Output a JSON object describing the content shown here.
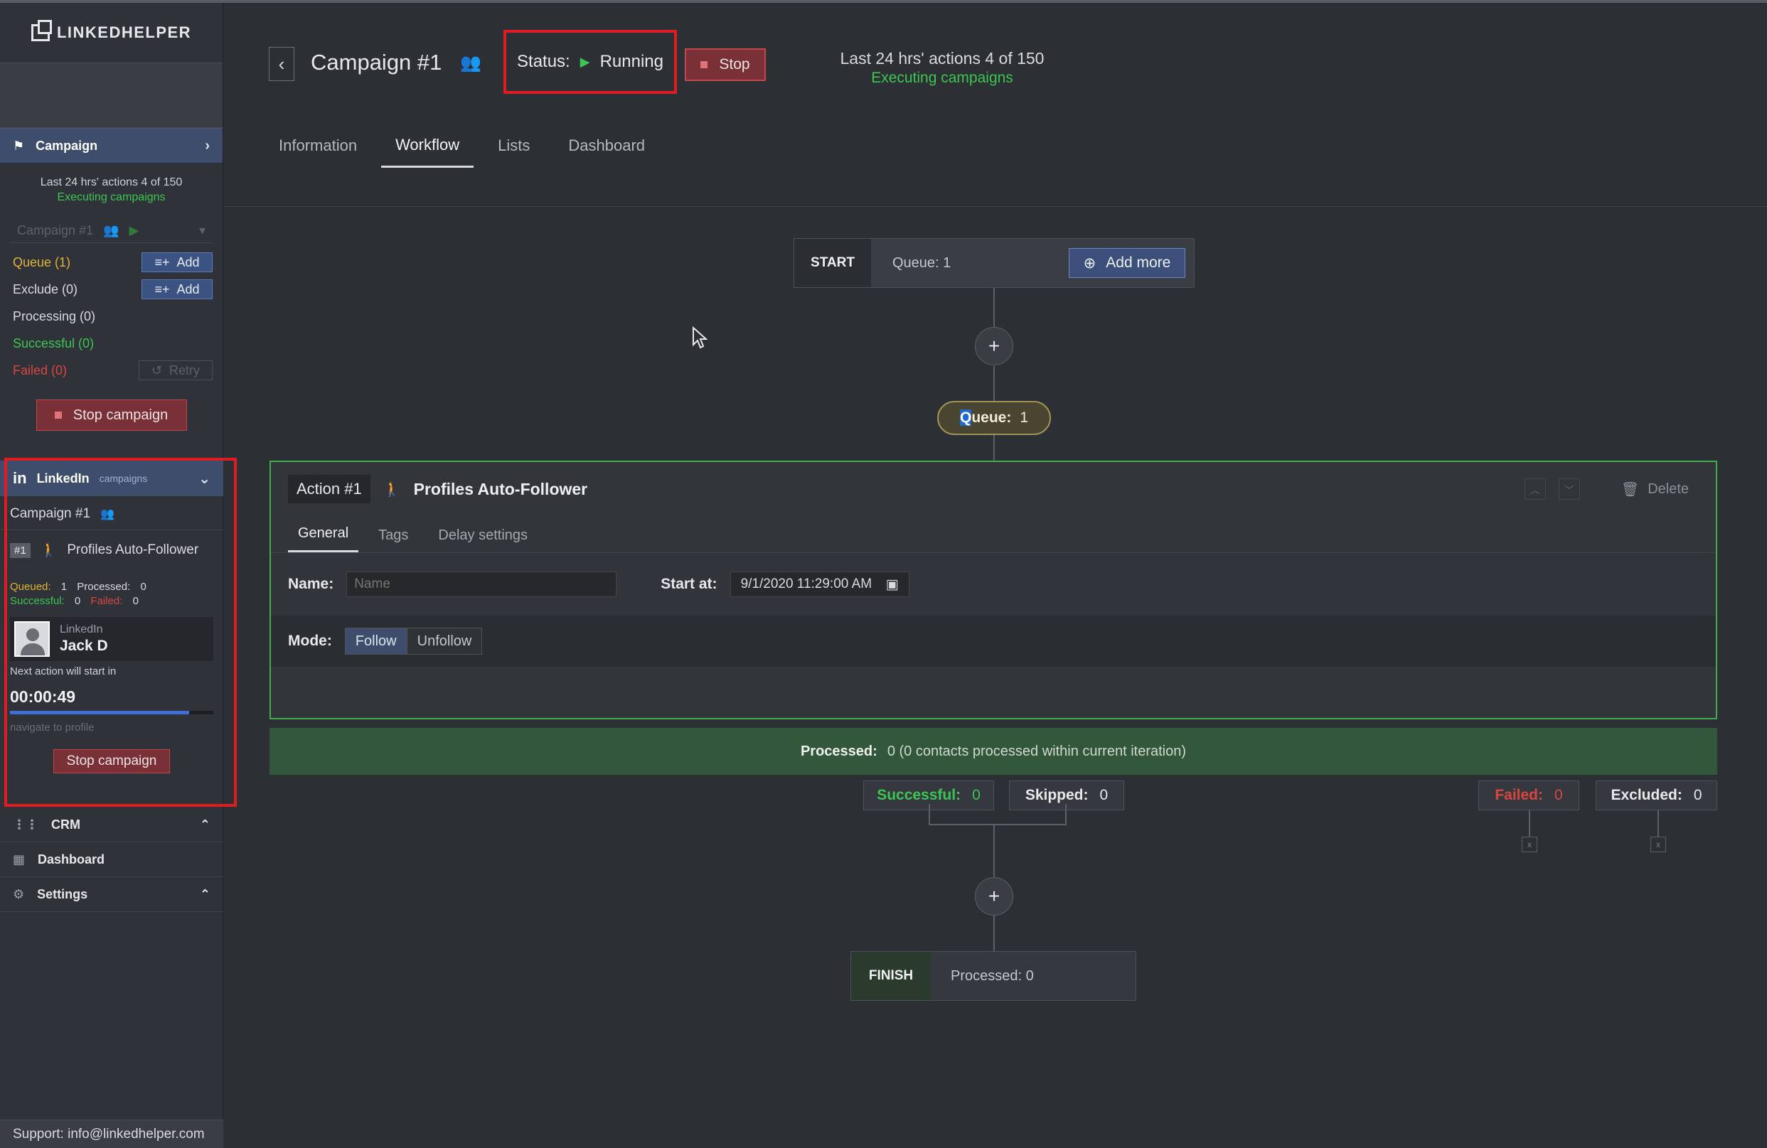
{
  "app": {
    "logo": "LINKEDHELPER",
    "support": "Support: info@linkedhelper.com"
  },
  "colors": {
    "accent": "#3d4d6b",
    "success": "#3cc552",
    "danger": "#d9463f",
    "warning": "#e0b436",
    "highlight_box": "#e01b22"
  },
  "sidebar": {
    "campaign_header": "Campaign",
    "stats_line": "Last 24 hrs' actions 4 of 150",
    "stats_status": "Executing campaigns",
    "campaign_select": "Campaign #1",
    "queue_label": "Queue (1)",
    "exclude_label": "Exclude (0)",
    "processing_label": "Processing (0)",
    "successful_label": "Successful (0)",
    "failed_label": "Failed (0)",
    "add_label": "Add",
    "retry_label": "Retry",
    "stop_campaign": "Stop campaign",
    "linkedin": {
      "title": "LinkedIn",
      "subtitle": "campaigns",
      "campaign_name": "Campaign #1",
      "action_num": "#1",
      "action_name": "Profiles Auto-Follower",
      "queued_label": "Queued:",
      "queued_value": "1",
      "processed_label": "Processed:",
      "processed_value": "0",
      "successful_label": "Successful:",
      "successful_value": "0",
      "failed_label": "Failed:",
      "failed_value": "0",
      "account_sub": "LinkedIn",
      "account_name": "Jack D",
      "next_action": "Next action will start in",
      "timer": "00:00:49",
      "progress": 0.88,
      "nav_status": "navigate to profile",
      "stop_campaign": "Stop campaign"
    },
    "nav": {
      "crm": "CRM",
      "dashboard": "Dashboard",
      "settings": "Settings"
    }
  },
  "header": {
    "title": "Campaign #1",
    "status_label": "Status:",
    "status_value": "Running",
    "stop": "Stop",
    "stats_line": "Last 24 hrs' actions 4 of 150",
    "stats_status": "Executing campaigns"
  },
  "tabs": [
    "Information",
    "Workflow",
    "Lists",
    "Dashboard"
  ],
  "workflow": {
    "start_label": "START",
    "start_queue": "Queue: 1",
    "add_more": "Add more",
    "queue_pill_label_hl": "Q",
    "queue_pill_label": "ueue:",
    "queue_pill_value": "1",
    "action": {
      "num": "Action #1",
      "title": "Profiles Auto-Follower",
      "delete": "Delete",
      "subtabs": [
        "General",
        "Tags",
        "Delay settings"
      ],
      "name_label": "Name:",
      "name_placeholder": "Name",
      "start_label": "Start at:",
      "start_value": "9/1/2020 11:29:00 AM",
      "mode_label": "Mode:",
      "mode_follow": "Follow",
      "mode_unfollow": "Unfollow"
    },
    "processed_label": "Processed:",
    "processed_value": "0 (0 contacts processed within current iteration)",
    "successful_label": "Successful:",
    "successful_value": "0",
    "skipped_label": "Skipped:",
    "skipped_value": "0",
    "failed_label": "Failed:",
    "failed_value": "0",
    "excluded_label": "Excluded:",
    "excluded_value": "0",
    "x_mark": "x",
    "finish_label": "FINISH",
    "finish_text": "Processed: 0"
  }
}
